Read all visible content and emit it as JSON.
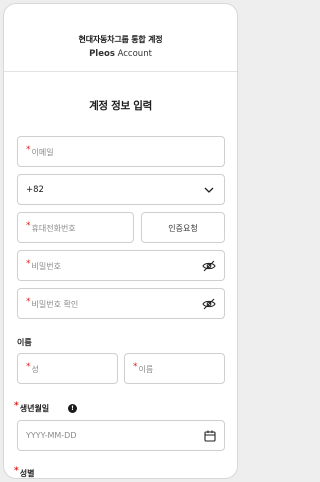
{
  "header": {
    "title": "현대자동차그룹 통합 계정",
    "subtitle_brand": "Pleos",
    "subtitle_rest": " Account"
  },
  "page": {
    "title": "계정 정보 입력"
  },
  "form": {
    "required_mark": "*",
    "email": {
      "placeholder": "이메일"
    },
    "country_code": {
      "value": "+82"
    },
    "phone": {
      "placeholder": "휴대전화번호"
    },
    "verify_button": {
      "label": "인증요청"
    },
    "password": {
      "placeholder": "비밀번호"
    },
    "password_confirm": {
      "placeholder": "비밀번호 확인"
    },
    "name_section": {
      "label": "이름"
    },
    "last_name": {
      "placeholder": "성"
    },
    "first_name": {
      "placeholder": "이름"
    },
    "birth_section": {
      "label": "생년월일",
      "info_glyph": "!"
    },
    "birth_date": {
      "placeholder": "YYYY-MM-DD"
    },
    "gender_section": {
      "label": "성별"
    }
  },
  "colors": {
    "required": "#e0201b",
    "border": "#cfcfcf",
    "placeholder": "#8a8a8a"
  },
  "icons": [
    "chevron-down-icon",
    "eye-off-icon",
    "calendar-icon",
    "info-icon"
  ]
}
